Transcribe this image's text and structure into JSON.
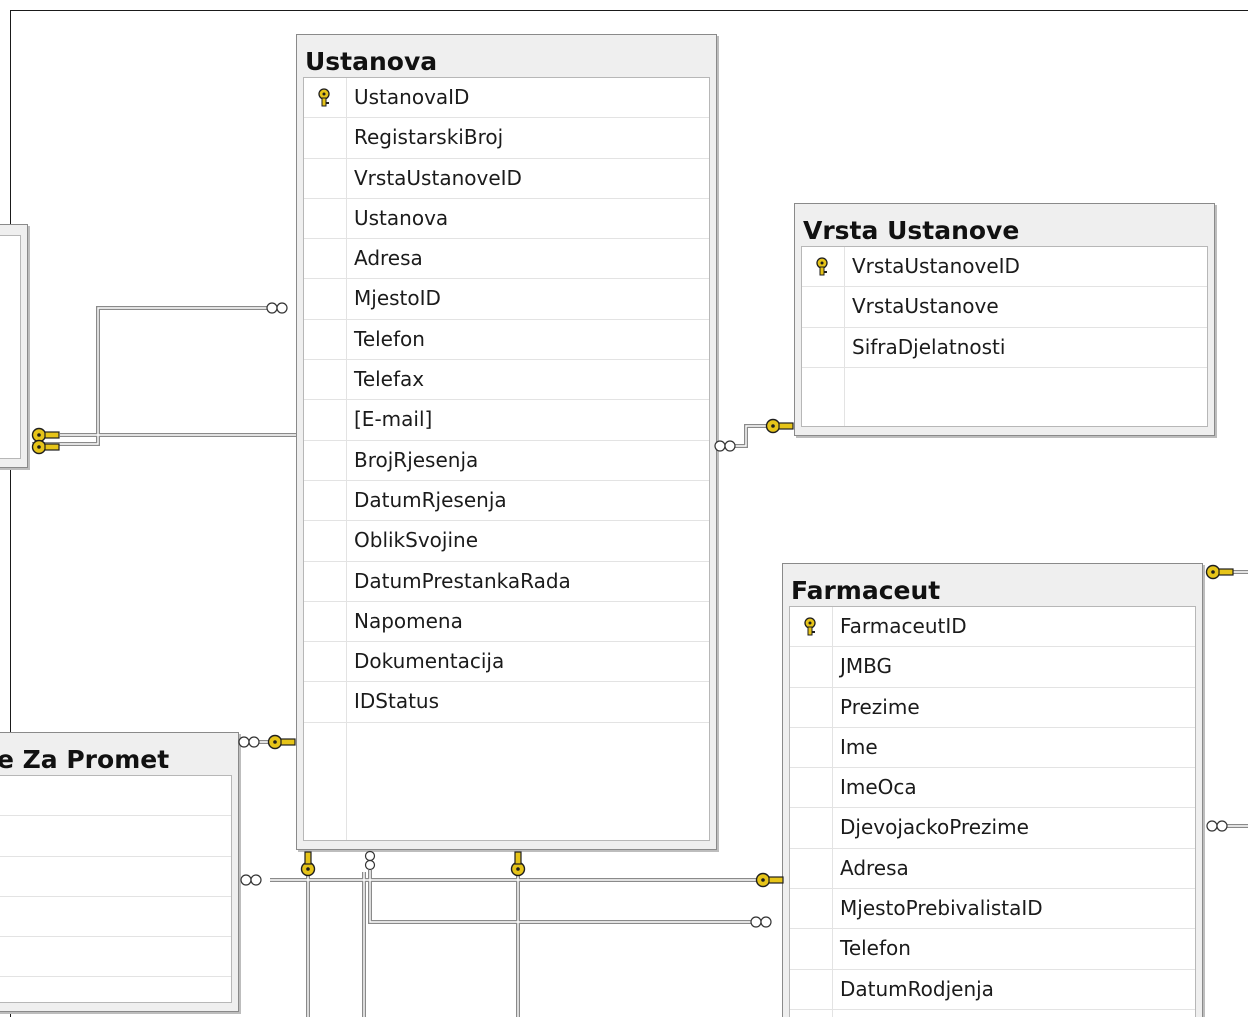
{
  "tables": {
    "ustanova": {
      "title": "Ustanova",
      "columns": [
        "UstanovaID",
        "RegistarskiBroj",
        "VrstaUstanoveID",
        "Ustanova",
        "Adresa",
        "MjestoID",
        "Telefon",
        "Telefax",
        "[E-mail]",
        "BrojRjesenja",
        "DatumRjesenja",
        "OblikSvojine",
        "DatumPrestankaRada",
        "Napomena",
        "Dokumentacija",
        "IDStatus"
      ],
      "primary_key": "UstanovaID"
    },
    "vrsta_ustanove": {
      "title": "Vrsta Ustanove",
      "columns": [
        "VrstaUstanoveID",
        "VrstaUstanove",
        "SifraDjelatnosti"
      ],
      "primary_key": "VrstaUstanoveID"
    },
    "farmaceut": {
      "title": "Farmaceut",
      "columns": [
        "FarmaceutID",
        "JMBG",
        "Prezime",
        "Ime",
        "ImeOca",
        "DjevojackoPrezime",
        "Adresa",
        "MjestoPrebivalistaID",
        "Telefon",
        "DatumRodjenja"
      ],
      "primary_key": "FarmaceutID"
    },
    "za_promet": {
      "title": "e Za Promet"
    }
  },
  "colors": {
    "key": "#e6c419",
    "connector": "#7a7a7a",
    "header_bg": "#efefef"
  }
}
